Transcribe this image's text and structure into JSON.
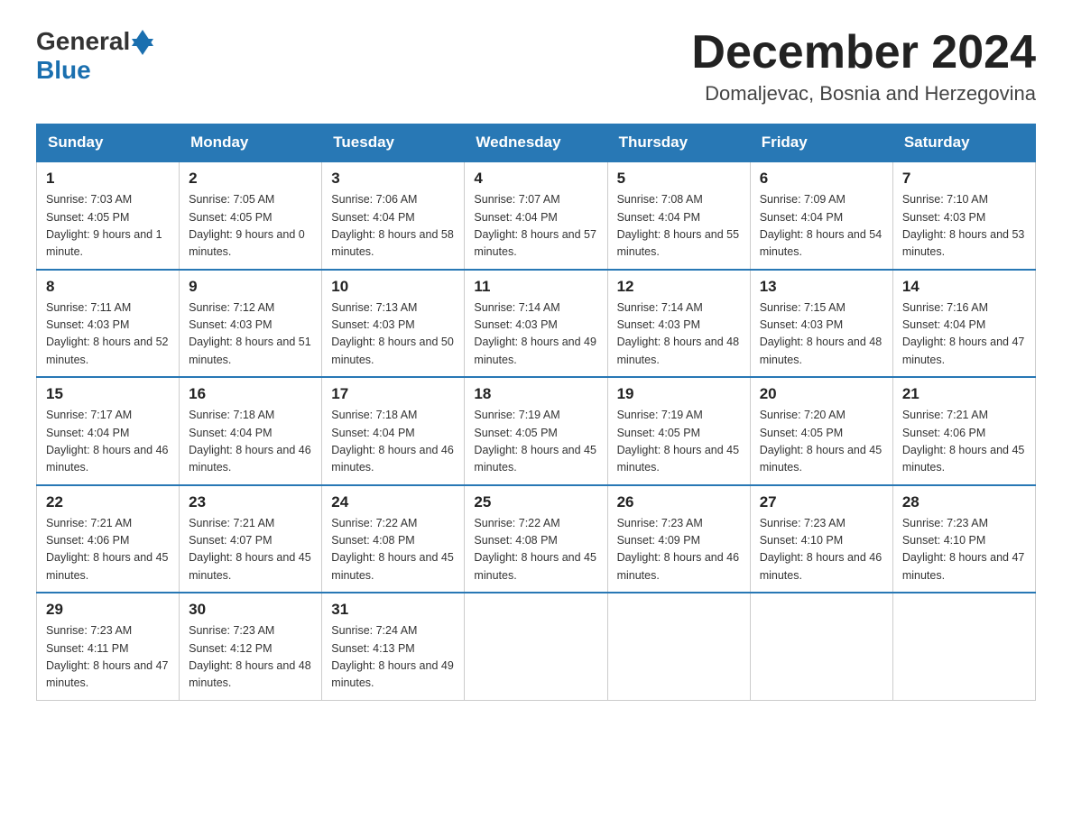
{
  "header": {
    "logo_general": "General",
    "logo_blue": "Blue",
    "month_title": "December 2024",
    "location": "Domaljevac, Bosnia and Herzegovina"
  },
  "weekdays": [
    "Sunday",
    "Monday",
    "Tuesday",
    "Wednesday",
    "Thursday",
    "Friday",
    "Saturday"
  ],
  "weeks": [
    [
      {
        "day": "1",
        "sunrise": "7:03 AM",
        "sunset": "4:05 PM",
        "daylight": "9 hours and 1 minute."
      },
      {
        "day": "2",
        "sunrise": "7:05 AM",
        "sunset": "4:05 PM",
        "daylight": "9 hours and 0 minutes."
      },
      {
        "day": "3",
        "sunrise": "7:06 AM",
        "sunset": "4:04 PM",
        "daylight": "8 hours and 58 minutes."
      },
      {
        "day": "4",
        "sunrise": "7:07 AM",
        "sunset": "4:04 PM",
        "daylight": "8 hours and 57 minutes."
      },
      {
        "day": "5",
        "sunrise": "7:08 AM",
        "sunset": "4:04 PM",
        "daylight": "8 hours and 55 minutes."
      },
      {
        "day": "6",
        "sunrise": "7:09 AM",
        "sunset": "4:04 PM",
        "daylight": "8 hours and 54 minutes."
      },
      {
        "day": "7",
        "sunrise": "7:10 AM",
        "sunset": "4:03 PM",
        "daylight": "8 hours and 53 minutes."
      }
    ],
    [
      {
        "day": "8",
        "sunrise": "7:11 AM",
        "sunset": "4:03 PM",
        "daylight": "8 hours and 52 minutes."
      },
      {
        "day": "9",
        "sunrise": "7:12 AM",
        "sunset": "4:03 PM",
        "daylight": "8 hours and 51 minutes."
      },
      {
        "day": "10",
        "sunrise": "7:13 AM",
        "sunset": "4:03 PM",
        "daylight": "8 hours and 50 minutes."
      },
      {
        "day": "11",
        "sunrise": "7:14 AM",
        "sunset": "4:03 PM",
        "daylight": "8 hours and 49 minutes."
      },
      {
        "day": "12",
        "sunrise": "7:14 AM",
        "sunset": "4:03 PM",
        "daylight": "8 hours and 48 minutes."
      },
      {
        "day": "13",
        "sunrise": "7:15 AM",
        "sunset": "4:03 PM",
        "daylight": "8 hours and 48 minutes."
      },
      {
        "day": "14",
        "sunrise": "7:16 AM",
        "sunset": "4:04 PM",
        "daylight": "8 hours and 47 minutes."
      }
    ],
    [
      {
        "day": "15",
        "sunrise": "7:17 AM",
        "sunset": "4:04 PM",
        "daylight": "8 hours and 46 minutes."
      },
      {
        "day": "16",
        "sunrise": "7:18 AM",
        "sunset": "4:04 PM",
        "daylight": "8 hours and 46 minutes."
      },
      {
        "day": "17",
        "sunrise": "7:18 AM",
        "sunset": "4:04 PM",
        "daylight": "8 hours and 46 minutes."
      },
      {
        "day": "18",
        "sunrise": "7:19 AM",
        "sunset": "4:05 PM",
        "daylight": "8 hours and 45 minutes."
      },
      {
        "day": "19",
        "sunrise": "7:19 AM",
        "sunset": "4:05 PM",
        "daylight": "8 hours and 45 minutes."
      },
      {
        "day": "20",
        "sunrise": "7:20 AM",
        "sunset": "4:05 PM",
        "daylight": "8 hours and 45 minutes."
      },
      {
        "day": "21",
        "sunrise": "7:21 AM",
        "sunset": "4:06 PM",
        "daylight": "8 hours and 45 minutes."
      }
    ],
    [
      {
        "day": "22",
        "sunrise": "7:21 AM",
        "sunset": "4:06 PM",
        "daylight": "8 hours and 45 minutes."
      },
      {
        "day": "23",
        "sunrise": "7:21 AM",
        "sunset": "4:07 PM",
        "daylight": "8 hours and 45 minutes."
      },
      {
        "day": "24",
        "sunrise": "7:22 AM",
        "sunset": "4:08 PM",
        "daylight": "8 hours and 45 minutes."
      },
      {
        "day": "25",
        "sunrise": "7:22 AM",
        "sunset": "4:08 PM",
        "daylight": "8 hours and 45 minutes."
      },
      {
        "day": "26",
        "sunrise": "7:23 AM",
        "sunset": "4:09 PM",
        "daylight": "8 hours and 46 minutes."
      },
      {
        "day": "27",
        "sunrise": "7:23 AM",
        "sunset": "4:10 PM",
        "daylight": "8 hours and 46 minutes."
      },
      {
        "day": "28",
        "sunrise": "7:23 AM",
        "sunset": "4:10 PM",
        "daylight": "8 hours and 47 minutes."
      }
    ],
    [
      {
        "day": "29",
        "sunrise": "7:23 AM",
        "sunset": "4:11 PM",
        "daylight": "8 hours and 47 minutes."
      },
      {
        "day": "30",
        "sunrise": "7:23 AM",
        "sunset": "4:12 PM",
        "daylight": "8 hours and 48 minutes."
      },
      {
        "day": "31",
        "sunrise": "7:24 AM",
        "sunset": "4:13 PM",
        "daylight": "8 hours and 49 minutes."
      },
      null,
      null,
      null,
      null
    ]
  ]
}
